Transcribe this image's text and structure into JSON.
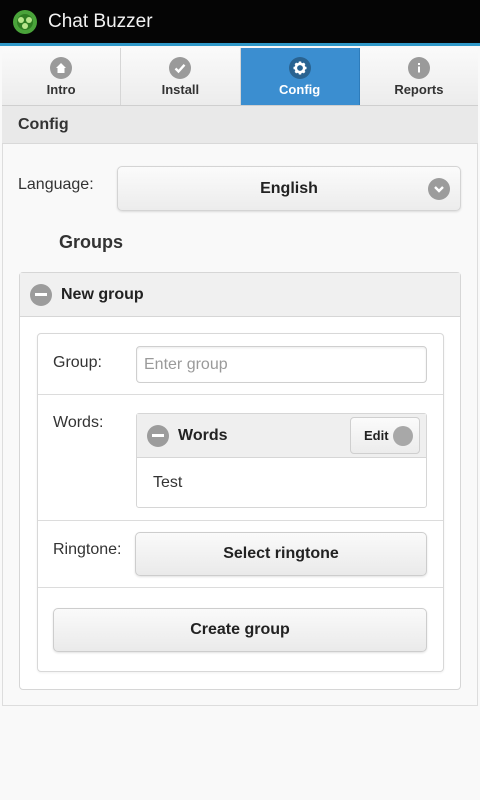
{
  "app": {
    "title": "Chat Buzzer",
    "accent_color": "#2f98c8"
  },
  "tabs": [
    {
      "label": "Intro",
      "icon": "home-icon"
    },
    {
      "label": "Install",
      "icon": "check-icon"
    },
    {
      "label": "Config",
      "icon": "gear-icon",
      "active": true
    },
    {
      "label": "Reports",
      "icon": "info-icon"
    }
  ],
  "section": {
    "title": "Config"
  },
  "language": {
    "label": "Language:",
    "selected": "English"
  },
  "groups": {
    "heading": "Groups",
    "new_group": {
      "header": "New group",
      "group_label": "Group:",
      "group_placeholder": "Enter group",
      "words_label": "Words:",
      "words_header": "Words",
      "edit_label": "Edit",
      "words": [
        "Test"
      ],
      "ringtone_label": "Ringtone:",
      "select_ringtone": "Select ringtone",
      "create_group": "Create group"
    }
  }
}
